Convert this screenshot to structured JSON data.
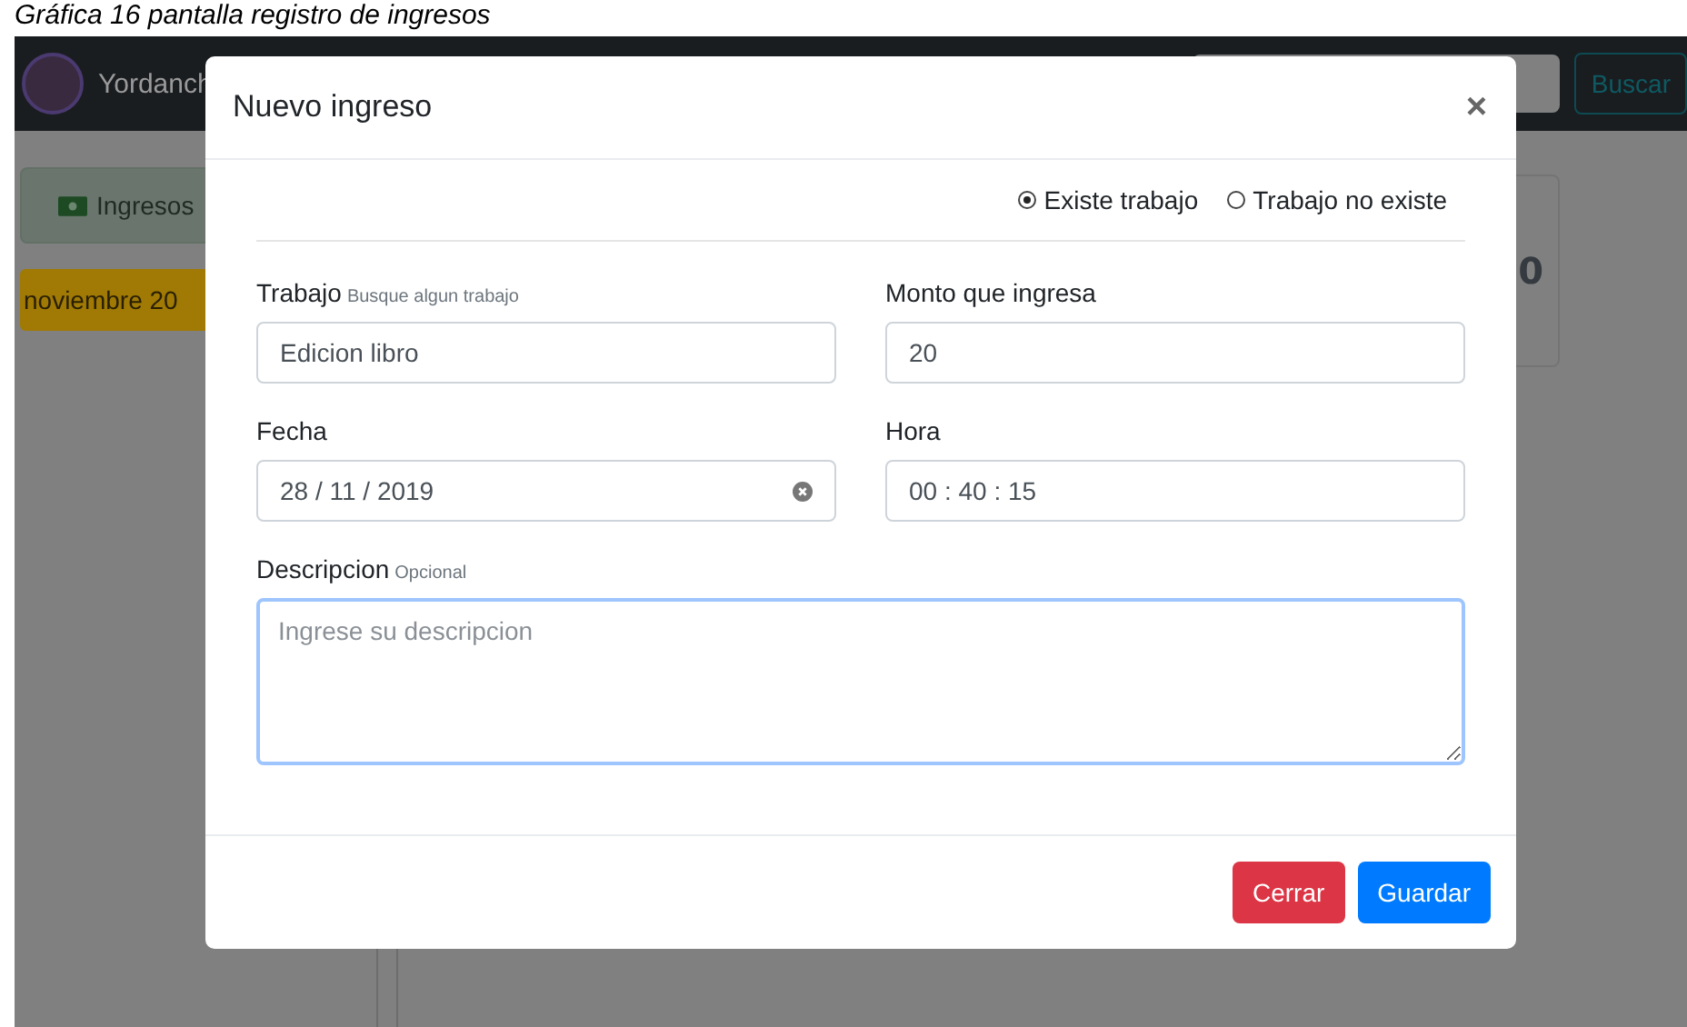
{
  "caption": "Gráfica 16 pantalla registro de ingresos",
  "navbar": {
    "brand": "Yordanch",
    "search_button": "Buscar"
  },
  "sidebar": {
    "button": "Ingresos",
    "badge": "noviembre 20"
  },
  "card": {
    "value": "0"
  },
  "modal": {
    "title": "Nuevo ingreso",
    "close": "×",
    "options": [
      {
        "label": "Existe trabajo",
        "selected": true
      },
      {
        "label": "Trabajo no existe",
        "selected": false
      }
    ],
    "fields": [
      {
        "kind": "text",
        "label": "Trabajo",
        "hint": "Busque algun trabajo",
        "value": "Edicion libro"
      },
      {
        "kind": "text",
        "label": "Monto que ingresa",
        "value": "20"
      },
      {
        "kind": "date",
        "label": "Fecha",
        "value": "28 / 11 / 2019"
      },
      {
        "kind": "text",
        "label": "Hora",
        "value": "00 : 40 : 15"
      }
    ],
    "description": {
      "label": "Descripcion",
      "hint": "Opcional",
      "placeholder": "Ingrese su descripcion"
    },
    "buttons": [
      {
        "kind": "danger",
        "label": "Cerrar"
      },
      {
        "kind": "primary",
        "label": "Guardar"
      }
    ]
  }
}
